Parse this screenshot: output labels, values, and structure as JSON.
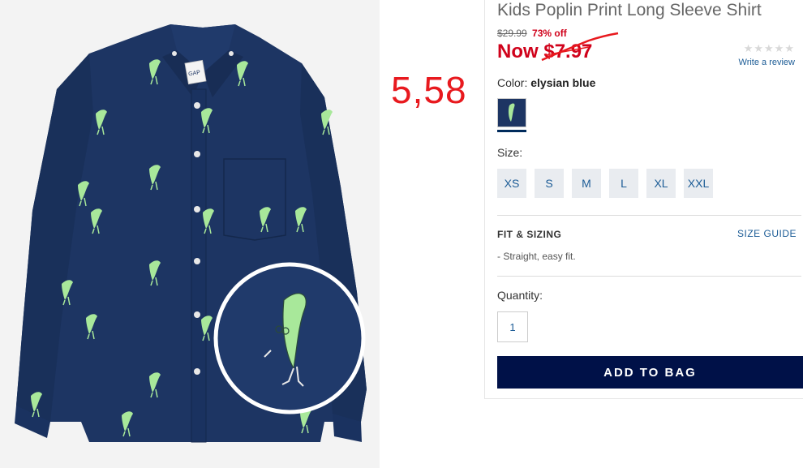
{
  "product": {
    "title": "Kids Poplin Print Long Sleeve Shirt",
    "was_price": "$29.99",
    "percent_off": "73% off",
    "now_label": "Now",
    "now_price": "$7.97"
  },
  "annotation": {
    "handwritten_price": "5,58"
  },
  "rating": {
    "stars": "★★★★★",
    "write_review": "Write a review"
  },
  "color": {
    "label": "Color:",
    "value": "elysian blue"
  },
  "size": {
    "label": "Size:",
    "options": [
      "XS",
      "S",
      "M",
      "L",
      "XL",
      "XXL"
    ]
  },
  "fit": {
    "label": "FIT & SIZING",
    "size_guide": "SIZE GUIDE",
    "note": "- Straight, easy fit."
  },
  "quantity": {
    "label": "Quantity:",
    "value": "1"
  },
  "cta": {
    "add_to_bag": "ADD TO BAG"
  },
  "brand": {
    "logo_text": "GAP"
  },
  "colors": {
    "shirt_navy": "#1d3563",
    "price_red": "#d0021b",
    "link_blue": "#1c5c96",
    "button_navy": "#001148",
    "annotation_red": "#e8191e"
  }
}
